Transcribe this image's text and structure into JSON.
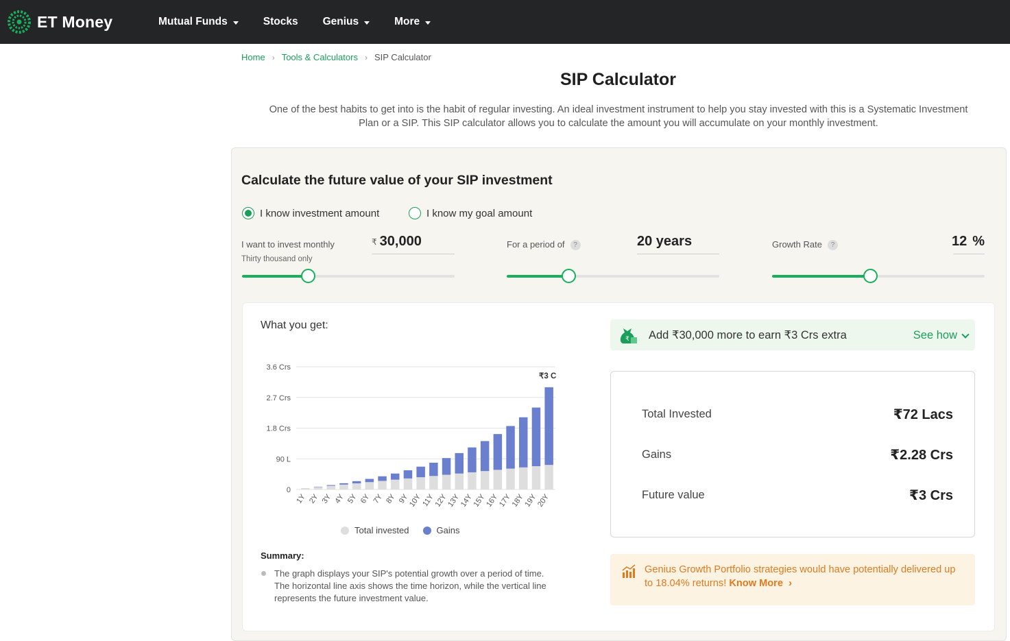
{
  "brand": {
    "name": "ET Money",
    "accent": "#18b05a"
  },
  "nav": [
    {
      "label": "Mutual Funds",
      "dropdown": true
    },
    {
      "label": "Stocks",
      "dropdown": false
    },
    {
      "label": "Genius",
      "dropdown": true
    },
    {
      "label": "More",
      "dropdown": true
    }
  ],
  "breadcrumb": {
    "home": "Home",
    "tools": "Tools & Calculators",
    "current": "SIP Calculator",
    "sep": "›"
  },
  "page": {
    "title": "SIP Calculator",
    "intro": "One of the best habits to get into is the habit of regular investing. An ideal investment instrument to help you stay invested with this is a Systematic Investment Plan or a SIP. This SIP calculator allows you to calculate the amount you will accumulate on your monthly investment."
  },
  "calculator": {
    "title": "Calculate the future value of your SIP investment",
    "mode_amount": "I know investment amount",
    "mode_goal": "I know my goal amount",
    "monthly_label": "I want to invest monthly",
    "monthly_sub": "Thirty thousand only",
    "rupee": "₹",
    "monthly_value": "30,000",
    "period_label": "For a period of",
    "period_value": "20 years",
    "rate_label": "Growth Rate",
    "rate_value": "12",
    "rate_unit": "%",
    "help": "?",
    "slider_monthly_fraction": 0.31,
    "slider_period_fraction": 0.29,
    "slider_rate_fraction": 0.46
  },
  "result_section": {
    "heading": "What you get:",
    "promo_text": "Add ₹30,000 more to earn ₹3 Crs extra",
    "promo_link": "See how",
    "total_invested_label": "Total Invested",
    "total_invested_value": "₹72 Lacs",
    "gains_label": "Gains",
    "gains_value": "₹2.28 Crs",
    "future_label": "Future value",
    "future_value": "₹3 Crs",
    "genius_text": "Genius Growth Portfolio strategies would have potentially delivered up to 18.04% returns!",
    "genius_link": "Know More",
    "summary_title": "Summary:",
    "summary_text": "The graph displays your SIP's potential growth over a period of time. The horizontal line axis shows the time horizon, while the vertical line represents the future investment value."
  },
  "chart_data": {
    "type": "bar",
    "stacked": true,
    "categories": [
      "1Y",
      "2Y",
      "3Y",
      "4Y",
      "5Y",
      "6Y",
      "7Y",
      "8Y",
      "9Y",
      "10Y",
      "11Y",
      "12Y",
      "13Y",
      "14Y",
      "15Y",
      "16Y",
      "17Y",
      "18Y",
      "19Y",
      "20Y"
    ],
    "series": [
      {
        "name": "Total invested",
        "color": "#dedede",
        "values": [
          0.036,
          0.072,
          0.108,
          0.144,
          0.18,
          0.216,
          0.252,
          0.288,
          0.324,
          0.36,
          0.396,
          0.432,
          0.468,
          0.504,
          0.54,
          0.576,
          0.612,
          0.648,
          0.684,
          0.72
        ]
      },
      {
        "name": "Gains",
        "color": "#6b7fcf",
        "values": [
          0.002,
          0.01,
          0.022,
          0.04,
          0.065,
          0.095,
          0.135,
          0.18,
          0.24,
          0.31,
          0.39,
          0.49,
          0.6,
          0.73,
          0.88,
          1.05,
          1.25,
          1.47,
          1.72,
          2.28
        ]
      }
    ],
    "y_ticks": [
      "0",
      "90 L",
      "1.8 Crs",
      "2.7 Crs",
      "3.6 Crs"
    ],
    "ylim": [
      0,
      3.6
    ],
    "y_unit": "Crs",
    "top_annotation": "₹3 C",
    "grid": true,
    "legend": "bottom"
  }
}
